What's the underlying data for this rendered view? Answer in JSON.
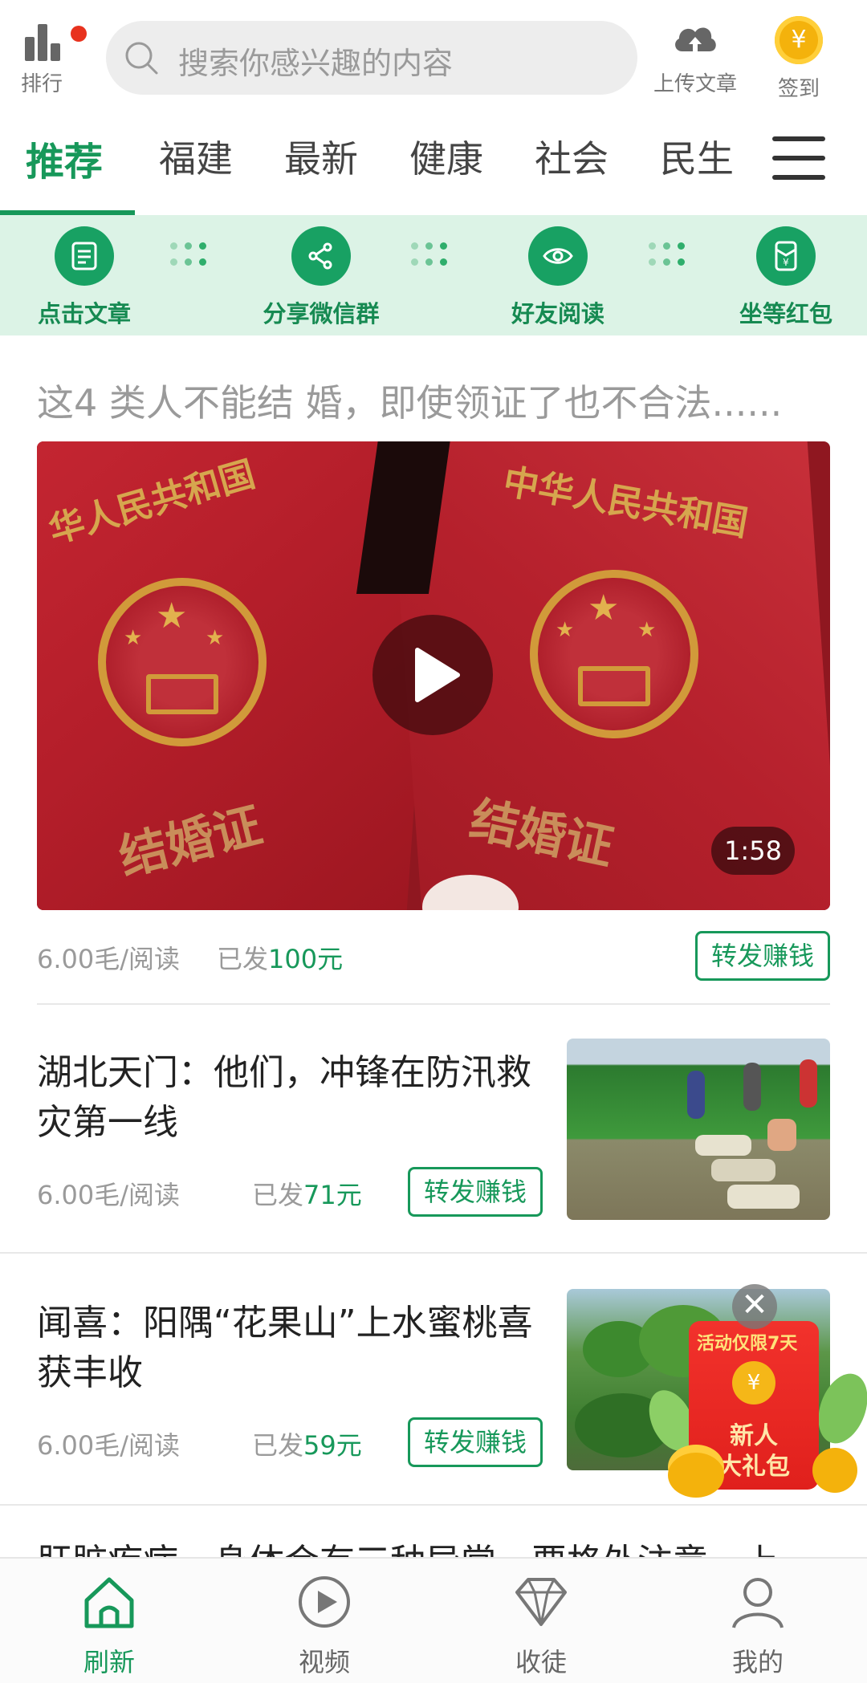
{
  "header": {
    "rank_label": "排行",
    "search_placeholder": "搜索你感兴趣的内容",
    "upload_label": "上传文章",
    "signin_label": "签到",
    "signin_icon": "¥"
  },
  "tabs": [
    {
      "label": "推荐",
      "active": true
    },
    {
      "label": "福建"
    },
    {
      "label": "最新"
    },
    {
      "label": "健康"
    },
    {
      "label": "社会"
    },
    {
      "label": "民生"
    }
  ],
  "steps": [
    {
      "label": "点击文章",
      "icon": "article-icon"
    },
    {
      "label": "分享微信群",
      "icon": "share-icon"
    },
    {
      "label": "好友阅读",
      "icon": "eye-icon"
    },
    {
      "label": "坐等红包",
      "icon": "red-packet-icon"
    }
  ],
  "feed": {
    "featured": {
      "title": "这4 类人不能结 婚，即使领证了也不合法......",
      "cover_text_left": "华人民共和国",
      "cover_text_right": "中华人民共和国",
      "cover_bottom_left": "结婚证",
      "cover_bottom_right": "结婚证",
      "duration": "1:58",
      "rate": "6.00毛/阅读",
      "paid_prefix": "已发",
      "paid_amount": "100元",
      "earn_label": "转发赚钱"
    },
    "items": [
      {
        "title": "湖北天门：他们，冲锋在防汛救灾第一线",
        "rate": "6.00毛/阅读",
        "paid_prefix": "已发",
        "paid_amount": "71元",
        "earn_label": "转发赚钱"
      },
      {
        "title": "闻喜：阳隅“花果山”上水蜜桃喜获丰收",
        "rate": "6.00毛/阅读",
        "paid_prefix": "已发",
        "paid_amount": "59元",
        "earn_label": "转发赚钱"
      }
    ],
    "partial_title": "肝脏疾病，身体会有三种异常，要格外注意，上"
  },
  "promo": {
    "close": "✕",
    "ribbon": "活动仅限7天",
    "coin": "¥",
    "line1": "新人",
    "line2": "大礼包"
  },
  "bottom_nav": [
    {
      "label": "刷新",
      "active": true
    },
    {
      "label": "视频"
    },
    {
      "label": "收徒"
    },
    {
      "label": "我的"
    }
  ],
  "colors": {
    "accent": "#17985a",
    "steps_bg": "#dcf3e6",
    "notification_dot": "#e8321e"
  }
}
